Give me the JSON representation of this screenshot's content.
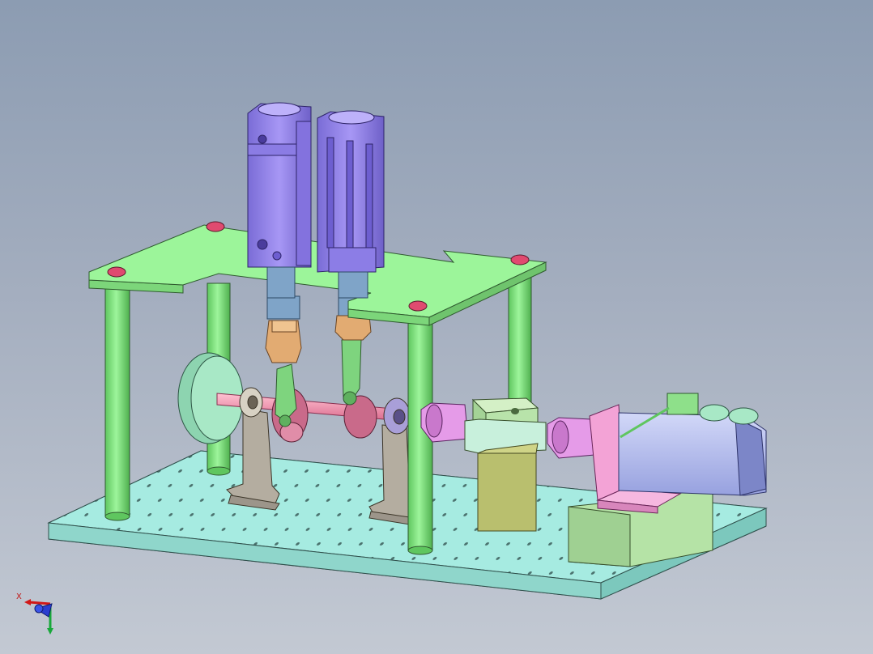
{
  "viewport": {
    "background_top": "#8c9cb2",
    "background_bottom": "#c3c9d3"
  },
  "triad": {
    "x_label": "X",
    "icon": "axis-triad-icon"
  },
  "colors": {
    "base_plate": "#a6ebe1",
    "top_plate": "#9cf59a",
    "columns": "#7ee67e",
    "cylinders": "#9b8aed",
    "shaft": "#f59ab4",
    "coupling": "#e59be8",
    "motor_body": "#b6bff0",
    "motor_bracket": "#f3a3d6",
    "blocks": "#b5e3a6",
    "flywheel": "#a8e8c6",
    "bearing_stands": "#b4ada0",
    "bolts": "#e04a70"
  }
}
